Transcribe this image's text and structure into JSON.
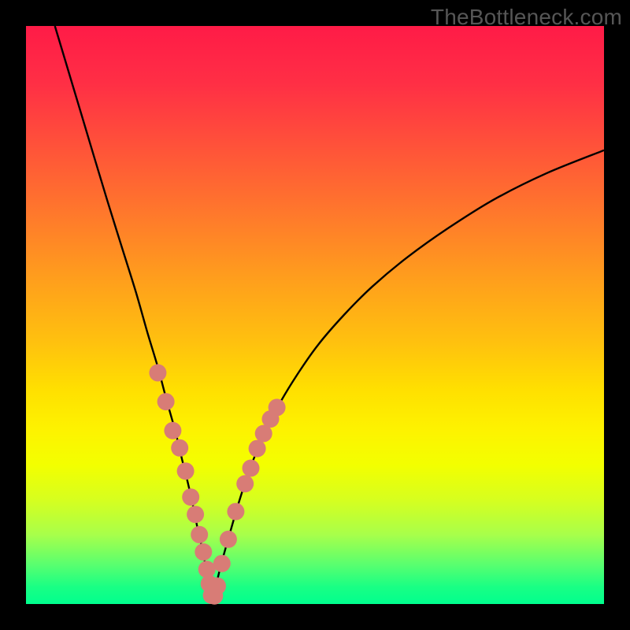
{
  "watermark": "TheBottleneck.com",
  "colors": {
    "background": "#000000",
    "gradient_top": "#ff1b47",
    "gradient_bottom": "#00ff8e",
    "curve": "#000000",
    "marker_fill": "#d87c76",
    "marker_stroke": "#c96a63"
  },
  "chart_data": {
    "type": "line",
    "title": "",
    "xlabel": "",
    "ylabel": "",
    "xlim": [
      0,
      100
    ],
    "ylim": [
      0,
      100
    ],
    "grid": false,
    "legend": false,
    "series": [
      {
        "name": "left-branch",
        "x": [
          5,
          8,
          11,
          14,
          16.5,
          19,
          21,
          22.8,
          24.4,
          25.8,
          27.0,
          28.0,
          28.9,
          29.7,
          30.4,
          31.0,
          31.5,
          32.1
        ],
        "values": [
          100,
          90,
          80,
          70,
          62,
          54,
          47,
          41,
          35,
          30,
          25,
          21,
          17,
          13,
          10,
          7,
          4,
          1.5
        ]
      },
      {
        "name": "right-branch",
        "x": [
          32.1,
          32.8,
          33.8,
          35.2,
          36.8,
          38.6,
          40.8,
          43.5,
          46.8,
          50.5,
          55,
          60,
          66,
          73,
          81,
          90,
          100
        ],
        "values": [
          0.8,
          3,
          7,
          12,
          17.5,
          23,
          28.5,
          34,
          39.5,
          44.8,
          50,
          55,
          60,
          65,
          70,
          74.5,
          78.5
        ]
      }
    ],
    "overlay": {
      "name": "highlight-markers",
      "type": "scatter",
      "x": [
        22.8,
        24.2,
        25.4,
        26.6,
        27.6,
        28.5,
        29.3,
        30.0,
        30.7,
        31.3,
        31.7,
        32.1,
        32.6,
        33.1,
        33.9,
        35.0,
        36.3,
        37.9,
        38.9,
        40.0,
        41.1,
        42.3,
        43.4
      ],
      "values": [
        40,
        35,
        30,
        27,
        23,
        18.5,
        15.5,
        12,
        9,
        6,
        3.5,
        1.5,
        1.4,
        3.1,
        7.0,
        11.2,
        16.0,
        20.8,
        23.5,
        26.9,
        29.5,
        32.0,
        34.0
      ]
    },
    "floor_segment": {
      "type": "line",
      "x": [
        31.5,
        33.0
      ],
      "values": [
        1.1,
        1.1
      ]
    }
  }
}
